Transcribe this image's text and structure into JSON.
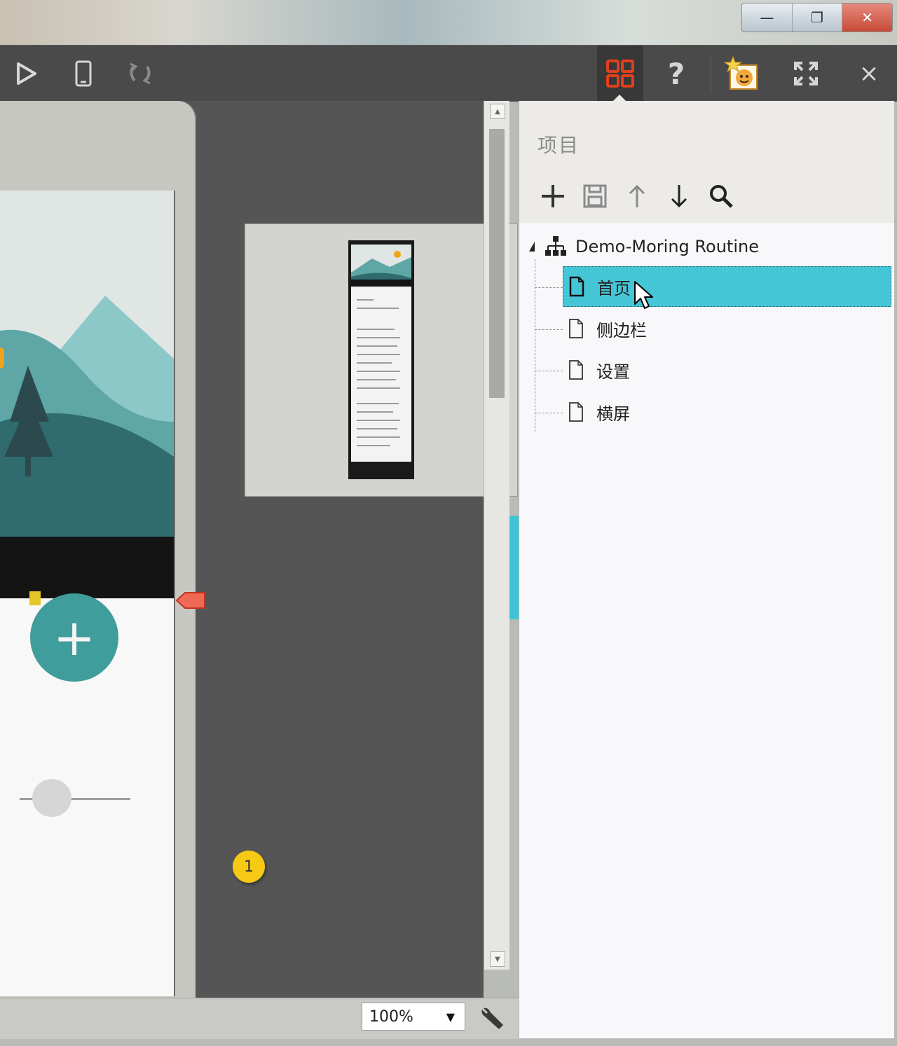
{
  "window": {
    "controls": {
      "minimize": "—",
      "restore": "❐",
      "close": "✕"
    }
  },
  "toolbar": {
    "icons": [
      "play-icon",
      "phone-icon",
      "sync-icon",
      "grid-icon",
      "help-icon",
      "badge-avatar-icon",
      "fullscreen-icon",
      "close-icon"
    ],
    "help_label": "?",
    "close_label": "×",
    "accent_color": "#e2401d"
  },
  "canvas": {
    "badge_number": "1",
    "fab_label": "+"
  },
  "status": {
    "zoom_value": "100%"
  },
  "panel": {
    "title": "项目",
    "tools": [
      "add-icon",
      "save-icon",
      "move-up-icon",
      "move-down-icon",
      "search-icon"
    ],
    "tree": {
      "root_label": "Demo-Moring Routine",
      "pages": [
        {
          "label": "首页",
          "selected": true
        },
        {
          "label": "侧边栏",
          "selected": false
        },
        {
          "label": "设置",
          "selected": false
        },
        {
          "label": "横屏",
          "selected": false
        }
      ]
    },
    "selection_color": "#45c6d6"
  }
}
